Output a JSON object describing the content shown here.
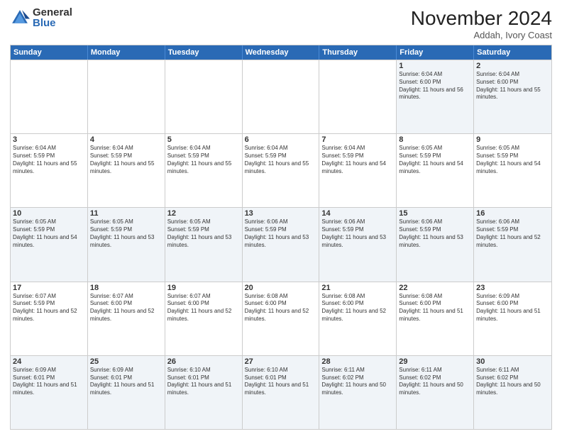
{
  "header": {
    "logo_general": "General",
    "logo_blue": "Blue",
    "month_title": "November 2024",
    "location": "Addah, Ivory Coast"
  },
  "calendar": {
    "days_of_week": [
      "Sunday",
      "Monday",
      "Tuesday",
      "Wednesday",
      "Thursday",
      "Friday",
      "Saturday"
    ],
    "rows": [
      [
        {
          "day": "",
          "empty": true
        },
        {
          "day": "",
          "empty": true
        },
        {
          "day": "",
          "empty": true
        },
        {
          "day": "",
          "empty": true
        },
        {
          "day": "",
          "empty": true
        },
        {
          "day": "1",
          "sunrise": "6:04 AM",
          "sunset": "6:00 PM",
          "daylight": "11 hours and 56 minutes."
        },
        {
          "day": "2",
          "sunrise": "6:04 AM",
          "sunset": "6:00 PM",
          "daylight": "11 hours and 55 minutes."
        }
      ],
      [
        {
          "day": "3",
          "sunrise": "6:04 AM",
          "sunset": "5:59 PM",
          "daylight": "11 hours and 55 minutes."
        },
        {
          "day": "4",
          "sunrise": "6:04 AM",
          "sunset": "5:59 PM",
          "daylight": "11 hours and 55 minutes."
        },
        {
          "day": "5",
          "sunrise": "6:04 AM",
          "sunset": "5:59 PM",
          "daylight": "11 hours and 55 minutes."
        },
        {
          "day": "6",
          "sunrise": "6:04 AM",
          "sunset": "5:59 PM",
          "daylight": "11 hours and 55 minutes."
        },
        {
          "day": "7",
          "sunrise": "6:04 AM",
          "sunset": "5:59 PM",
          "daylight": "11 hours and 54 minutes."
        },
        {
          "day": "8",
          "sunrise": "6:05 AM",
          "sunset": "5:59 PM",
          "daylight": "11 hours and 54 minutes."
        },
        {
          "day": "9",
          "sunrise": "6:05 AM",
          "sunset": "5:59 PM",
          "daylight": "11 hours and 54 minutes."
        }
      ],
      [
        {
          "day": "10",
          "sunrise": "6:05 AM",
          "sunset": "5:59 PM",
          "daylight": "11 hours and 54 minutes."
        },
        {
          "day": "11",
          "sunrise": "6:05 AM",
          "sunset": "5:59 PM",
          "daylight": "11 hours and 53 minutes."
        },
        {
          "day": "12",
          "sunrise": "6:05 AM",
          "sunset": "5:59 PM",
          "daylight": "11 hours and 53 minutes."
        },
        {
          "day": "13",
          "sunrise": "6:06 AM",
          "sunset": "5:59 PM",
          "daylight": "11 hours and 53 minutes."
        },
        {
          "day": "14",
          "sunrise": "6:06 AM",
          "sunset": "5:59 PM",
          "daylight": "11 hours and 53 minutes."
        },
        {
          "day": "15",
          "sunrise": "6:06 AM",
          "sunset": "5:59 PM",
          "daylight": "11 hours and 53 minutes."
        },
        {
          "day": "16",
          "sunrise": "6:06 AM",
          "sunset": "5:59 PM",
          "daylight": "11 hours and 52 minutes."
        }
      ],
      [
        {
          "day": "17",
          "sunrise": "6:07 AM",
          "sunset": "5:59 PM",
          "daylight": "11 hours and 52 minutes."
        },
        {
          "day": "18",
          "sunrise": "6:07 AM",
          "sunset": "6:00 PM",
          "daylight": "11 hours and 52 minutes."
        },
        {
          "day": "19",
          "sunrise": "6:07 AM",
          "sunset": "6:00 PM",
          "daylight": "11 hours and 52 minutes."
        },
        {
          "day": "20",
          "sunrise": "6:08 AM",
          "sunset": "6:00 PM",
          "daylight": "11 hours and 52 minutes."
        },
        {
          "day": "21",
          "sunrise": "6:08 AM",
          "sunset": "6:00 PM",
          "daylight": "11 hours and 52 minutes."
        },
        {
          "day": "22",
          "sunrise": "6:08 AM",
          "sunset": "6:00 PM",
          "daylight": "11 hours and 51 minutes."
        },
        {
          "day": "23",
          "sunrise": "6:09 AM",
          "sunset": "6:00 PM",
          "daylight": "11 hours and 51 minutes."
        }
      ],
      [
        {
          "day": "24",
          "sunrise": "6:09 AM",
          "sunset": "6:01 PM",
          "daylight": "11 hours and 51 minutes."
        },
        {
          "day": "25",
          "sunrise": "6:09 AM",
          "sunset": "6:01 PM",
          "daylight": "11 hours and 51 minutes."
        },
        {
          "day": "26",
          "sunrise": "6:10 AM",
          "sunset": "6:01 PM",
          "daylight": "11 hours and 51 minutes."
        },
        {
          "day": "27",
          "sunrise": "6:10 AM",
          "sunset": "6:01 PM",
          "daylight": "11 hours and 51 minutes."
        },
        {
          "day": "28",
          "sunrise": "6:11 AM",
          "sunset": "6:02 PM",
          "daylight": "11 hours and 50 minutes."
        },
        {
          "day": "29",
          "sunrise": "6:11 AM",
          "sunset": "6:02 PM",
          "daylight": "11 hours and 50 minutes."
        },
        {
          "day": "30",
          "sunrise": "6:11 AM",
          "sunset": "6:02 PM",
          "daylight": "11 hours and 50 minutes."
        }
      ]
    ]
  }
}
